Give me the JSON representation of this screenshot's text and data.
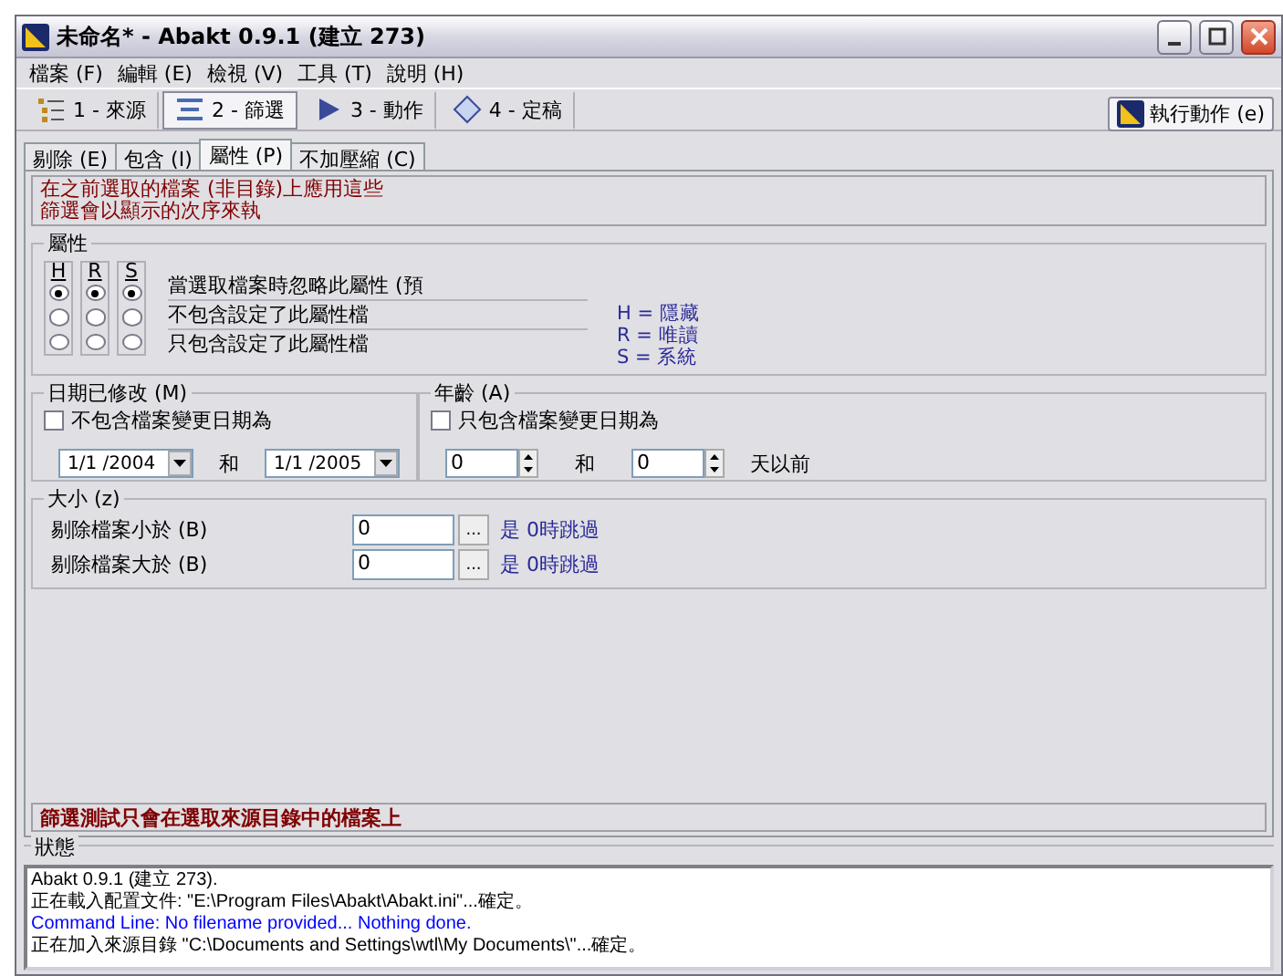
{
  "window": {
    "title": "未命名* - Abakt 0.9.1 (建立 273)"
  },
  "menu": [
    "檔案 (F)",
    "編輯 (E)",
    "檢視 (V)",
    "工具 (T)",
    "說明 (H)"
  ],
  "steps": [
    {
      "label": "1 - 來源",
      "selected": false
    },
    {
      "label": "2 - 篩選",
      "selected": true
    },
    {
      "label": "3 - 動作",
      "selected": false
    },
    {
      "label": "4 - 定稿",
      "selected": false
    }
  ],
  "run_button": "執行動作 (e)",
  "tabs": [
    {
      "label": "剔除 (E)",
      "selected": false
    },
    {
      "label": "包含 (I)",
      "selected": false
    },
    {
      "label": "屬性 (P)",
      "selected": true
    },
    {
      "label": "不加壓縮 (C)",
      "selected": false
    }
  ],
  "info": [
    "在之前選取的檔案 (非目錄)上應用這些",
    "篩選會以顯示的次序來執"
  ],
  "attributes": {
    "title": "屬性",
    "columns": [
      {
        "label": "H",
        "options": [
          {
            "selected": true
          },
          {
            "selected": false
          },
          {
            "selected": false
          }
        ]
      },
      {
        "label": "R",
        "options": [
          {
            "selected": true
          },
          {
            "selected": false
          },
          {
            "selected": false
          }
        ]
      },
      {
        "label": "S",
        "options": [
          {
            "selected": true
          },
          {
            "selected": false
          },
          {
            "selected": false
          }
        ]
      }
    ],
    "rows": [
      "當選取檔案時忽略此屬性 (預",
      "不包含設定了此屬性檔",
      "只包含設定了此屬性檔"
    ],
    "legend": [
      "H = 隱藏",
      "R = 唯讀",
      "S = 系統"
    ]
  },
  "date_modified": {
    "title": "日期已修改 (M)",
    "checkbox": {
      "label": "不包含檔案變更日期為",
      "checked": false
    },
    "from": "1/1 /2004",
    "and": "和",
    "to": "1/1 /2005"
  },
  "age": {
    "title": "年齡 (A)",
    "checkbox": {
      "label": "只包含檔案變更日期為",
      "checked": false
    },
    "from": "0",
    "and": "和",
    "to": "0",
    "unit": "天以前"
  },
  "size": {
    "title": "大小 (z)",
    "rows": [
      {
        "label": "剔除檔案小於 (B)",
        "value": "0",
        "button": "...",
        "hint": "是 0時跳過"
      },
      {
        "label": "剔除檔案大於 (B)",
        "value": "0",
        "button": "...",
        "hint": "是 0時跳過"
      }
    ]
  },
  "notice": "篩選測試只會在選取來源目錄中的檔案上",
  "status": {
    "title": "狀態",
    "lines": [
      {
        "text": "Abakt 0.9.1 (建立 273).",
        "color": "#000000"
      },
      {
        "text": "正在載入配置文件: \"E:\\Program Files\\Abakt\\Abakt.ini\"...確定。",
        "color": "#000000"
      },
      {
        "text": "Command Line: No filename provided... Nothing done.",
        "color": "#0000ff"
      },
      {
        "text": "正在加入來源目錄 \"C:\\Documents and Settings\\wtl\\My Documents\\\"...確定。",
        "color": "#000000"
      }
    ]
  }
}
